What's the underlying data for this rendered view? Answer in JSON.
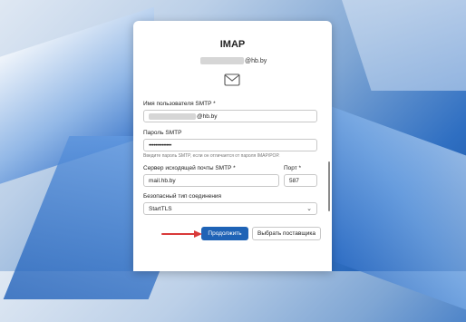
{
  "dialog": {
    "title": "IMAP",
    "account_suffix": "@hb.by"
  },
  "form": {
    "smtp_user_label": "Имя пользователя SMTP *",
    "smtp_user_suffix": "@hb.by",
    "smtp_password_label": "Пароль SMTP",
    "smtp_password_value": "••••••••••••••",
    "smtp_password_hint": "Введите пароль SMTP, если он отличается от пароля IMAP/POP.",
    "smtp_server_label": "Сервер исходящей почты SMTP *",
    "smtp_server_value": "mail.hb.by",
    "port_label": "Порт *",
    "port_value": "587",
    "security_label": "Безопасный тип соединения",
    "security_value": "StartTLS"
  },
  "buttons": {
    "continue_label": "Продолжить",
    "choose_provider_label": "Выбрать поставщика"
  },
  "colors": {
    "accent": "#1f63b6",
    "annotation_arrow": "#d93a3a"
  }
}
